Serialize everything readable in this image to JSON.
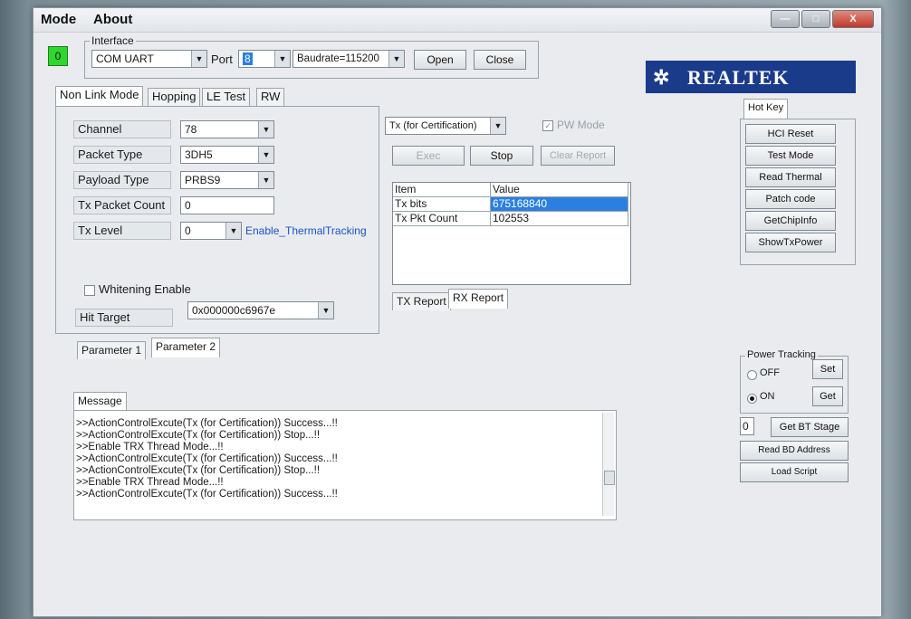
{
  "menu": {
    "mode": "Mode",
    "about": "About"
  },
  "window_buttons": {
    "minimize": "—",
    "maximize": "□",
    "close": "X"
  },
  "indicator": "0",
  "interface": {
    "group_title": "Interface",
    "interface_value": "COM UART",
    "port_label": "Port",
    "port_value": "8",
    "baudrate_value": "Baudrate=115200",
    "open_label": "Open",
    "close_label": "Close"
  },
  "logo": {
    "text": "REALTEK"
  },
  "tabs": [
    "Non Link Mode",
    "Hopping",
    "LE Test",
    "RW"
  ],
  "params": {
    "channel_label": "Channel",
    "channel_value": "78",
    "packet_type_label": "Packet Type",
    "packet_type_value": "3DH5",
    "payload_type_label": "Payload Type",
    "payload_type_value": "PRBS9",
    "tx_packet_count_label": "Tx Packet Count",
    "tx_packet_count_value": "0",
    "tx_level_label": "Tx Level",
    "tx_level_value": "0",
    "thermal_link": "Enable_ThermalTracking",
    "whitening_label": "Whitening Enable",
    "hit_target_label": "Hit Target",
    "hit_target_value": "0x000000c6967e",
    "subtab1": "Parameter 1",
    "subtab2": "Parameter 2"
  },
  "tx": {
    "mode_value": "Tx (for Certification)",
    "pw_mode_label": "PW Mode",
    "exec_label": "Exec",
    "stop_label": "Stop",
    "clear_report_label": "Clear Report",
    "table": {
      "headers": [
        "Item",
        "Value"
      ],
      "rows": [
        [
          "Tx bits",
          "675168840"
        ],
        [
          "Tx Pkt Count",
          "102553"
        ]
      ]
    },
    "report_tabs": [
      "TX Report",
      "RX Report"
    ]
  },
  "hotkey": {
    "tab": "Hot Key",
    "buttons": [
      "HCI Reset",
      "Test Mode",
      "Read Thermal",
      "Patch code",
      "GetChipInfo",
      "ShowTxPower"
    ]
  },
  "power_tracking": {
    "title": "Power Tracking",
    "off_label": "OFF",
    "on_label": "ON",
    "set_label": "Set",
    "get_label": "Get"
  },
  "bt_stage": {
    "value": "0",
    "button": "Get BT Stage"
  },
  "read_bd_address": "Read BD Address",
  "load_script": "Load Script",
  "message": {
    "tab": "Message",
    "lines": [
      ">>ActionControlExcute(Tx (for Certification)) Success...!!",
      ">>ActionControlExcute(Tx (for Certification)) Stop...!!",
      ">>Enable TRX Thread Mode...!!",
      ">>ActionControlExcute(Tx (for Certification)) Success...!!",
      ">>ActionControlExcute(Tx (for Certification)) Stop...!!",
      ">>Enable TRX Thread Mode...!!",
      ">>ActionControlExcute(Tx (for Certification)) Success...!!"
    ]
  }
}
